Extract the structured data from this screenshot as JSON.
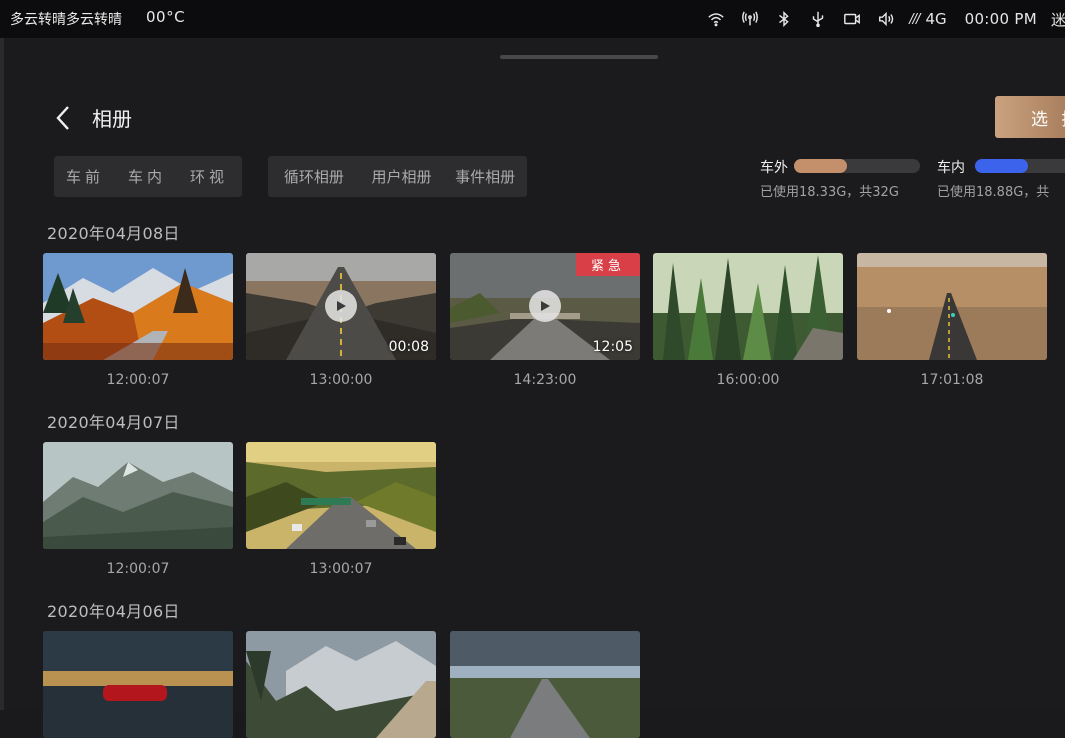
{
  "status_bar": {
    "weather": "多云转晴多云转晴",
    "temperature": "00°C",
    "signal": "///",
    "network": "4G",
    "time": "00:00 PM",
    "cut_off_text": "迷",
    "icons": [
      "wifi-icon",
      "hotspot-icon",
      "bluetooth-icon",
      "usb-icon",
      "camera-icon",
      "volume-icon"
    ]
  },
  "header": {
    "title": "相册",
    "select_label": "选 择"
  },
  "camera_tabs": [
    {
      "label": "车前",
      "active": true
    },
    {
      "label": "车内",
      "active": false
    },
    {
      "label": "环视",
      "active": false
    }
  ],
  "album_tabs": [
    {
      "label": "循环相册",
      "active": true
    },
    {
      "label": "用户相册",
      "active": false
    },
    {
      "label": "事件相册",
      "active": false
    }
  ],
  "storage": {
    "external": {
      "label": "车外",
      "usage": "已使用18.33G，共32G",
      "fraction": 0.42,
      "color": "#c48f6b"
    },
    "internal": {
      "label": "车内",
      "usage": "已使用18.88G，共",
      "fraction": 0.44,
      "color": "#3b63ec"
    }
  },
  "groups": [
    {
      "date": "2020年04月08日",
      "items": [
        {
          "time": "12:00:07",
          "scene": "autumn",
          "video": false
        },
        {
          "time": "13:00:00",
          "scene": "desert-road",
          "video": true,
          "duration": "00:08"
        },
        {
          "time": "14:23:00",
          "scene": "storm-road",
          "video": true,
          "duration": "12:05",
          "badge": "紧急"
        },
        {
          "time": "16:00:00",
          "scene": "forest",
          "video": false
        },
        {
          "time": "17:01:08",
          "scene": "plain-road",
          "video": false
        }
      ]
    },
    {
      "date": "2020年04月07日",
      "items": [
        {
          "time": "12:00:07",
          "scene": "mountain",
          "video": false
        },
        {
          "time": "13:00:07",
          "scene": "highway",
          "video": false
        }
      ]
    },
    {
      "date": "2020年04月06日",
      "items": [
        {
          "time": "",
          "scene": "car-sunset",
          "video": false
        },
        {
          "time": "",
          "scene": "alpine",
          "video": false
        },
        {
          "time": "",
          "scene": "cloud-road",
          "video": false
        }
      ]
    }
  ]
}
